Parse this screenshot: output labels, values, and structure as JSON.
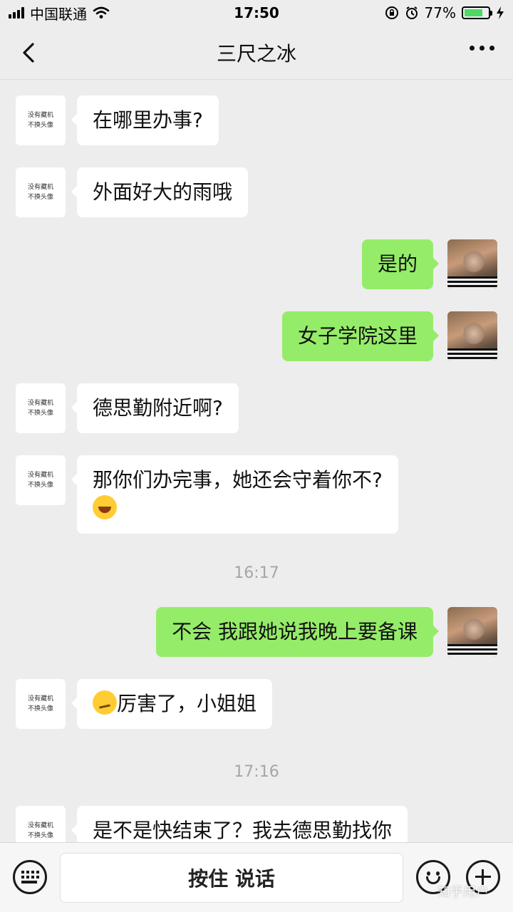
{
  "status_bar": {
    "carrier": "中国联通",
    "time": "17:50",
    "battery": "77%",
    "battery_level": 0.77
  },
  "header": {
    "title": "三尺之冰"
  },
  "contact_avatar_text": "没有藏机 不换头像",
  "messages": [
    {
      "from": "other",
      "text": "在哪里办事?"
    },
    {
      "from": "other",
      "text": "外面好大的雨哦"
    },
    {
      "from": "me",
      "text": "是的"
    },
    {
      "from": "me",
      "text": "女子学院这里"
    },
    {
      "from": "other",
      "text": "德思勤附近啊?"
    },
    {
      "from": "other",
      "text": "那你们办完事，她还会守着你不?",
      "emoji": "laughing-crying-emoji"
    },
    {
      "from": "me",
      "text": "不会 我跟她说我晚上要备课"
    },
    {
      "from": "other",
      "text": "厉害了，小姐姐",
      "emoji": "smirk-emoji"
    },
    {
      "from": "other",
      "text": "是不是快结束了？我去德思勤找你"
    }
  ],
  "timestamps": [
    "16:17",
    "17:16"
  ],
  "input_bar": {
    "hold_to_talk": "按住 说话"
  },
  "watermark": "知乎用户",
  "colors": {
    "background": "#ededed",
    "incoming_bubble": "#ffffff",
    "outgoing_bubble": "#95ec69",
    "battery_fill": "#4cd964"
  },
  "icons": [
    "back-icon",
    "more-icon",
    "wifi-icon",
    "keyboard-icon",
    "emoji-icon",
    "plus-icon"
  ]
}
